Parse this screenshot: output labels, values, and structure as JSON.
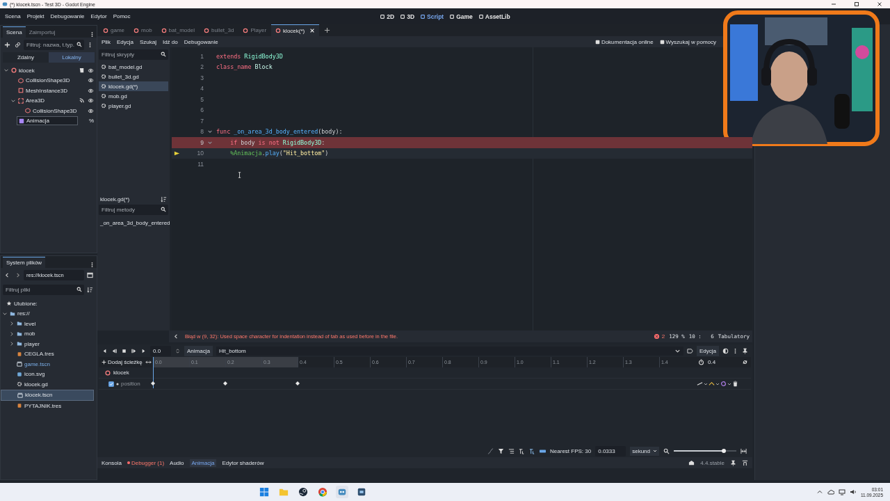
{
  "window": {
    "title": "(*) klocek.tscn - Test 3D - Godot Engine"
  },
  "menu": [
    "Scena",
    "Projekt",
    "Debugowanie",
    "Edytor",
    "Pomoc"
  ],
  "workspaces": [
    {
      "label": "2D",
      "selected": false
    },
    {
      "label": "3D",
      "selected": false
    },
    {
      "label": "Script",
      "selected": true
    },
    {
      "label": "Game",
      "selected": false
    },
    {
      "label": "AssetLib",
      "selected": false
    }
  ],
  "scene_dock": {
    "tabs": [
      {
        "label": "Scena",
        "selected": true
      },
      {
        "label": "Zaimportuj",
        "selected": false
      }
    ],
    "filter": {
      "placeholder": "Filtruj: nazwa, t.typ."
    },
    "modes": [
      {
        "label": "Zdalny",
        "selected": false
      },
      {
        "label": "Lokalny",
        "selected": true
      }
    ],
    "tree": [
      {
        "name": "klocek",
        "kind": "body",
        "expanded": true,
        "script": true,
        "visible": true,
        "children": [
          {
            "name": "CollisionShape3D",
            "kind": "shape",
            "visible": true
          },
          {
            "name": "MeshInstance3D",
            "kind": "mesh",
            "visible": true
          },
          {
            "name": "Area3D",
            "kind": "area",
            "expanded": true,
            "signals": true,
            "visible": true,
            "children": [
              {
                "name": "CollisionShape3D",
                "kind": "shape",
                "visible": true
              }
            ]
          },
          {
            "name": "Animacja",
            "kind": "animation",
            "editing": true,
            "badge": "%"
          }
        ]
      }
    ]
  },
  "filesystem": {
    "tab": "System plików",
    "path": "res://klocek.tscn",
    "filter": {
      "placeholder": "Filtruj pliki"
    },
    "favorites": "Ulubione:",
    "tree": [
      {
        "name": "res://",
        "kind": "folder",
        "expanded": true,
        "selected": false,
        "accent": false,
        "children": [
          {
            "name": "level",
            "kind": "folder",
            "expanded": false,
            "selected": false,
            "accent": false
          },
          {
            "name": "mob",
            "kind": "folder",
            "expanded": false,
            "selected": false,
            "accent": false
          },
          {
            "name": "player",
            "kind": "folder",
            "expanded": false,
            "selected": false,
            "accent": false
          },
          {
            "name": "CEGLA.tres",
            "kind": "resource",
            "selected": false,
            "accent": false
          },
          {
            "name": "game.tscn",
            "kind": "scene",
            "selected": false,
            "accent": true
          },
          {
            "name": "icon.svg",
            "selected": false,
            "accent": false
          },
          {
            "name": "klocek.gd",
            "kind": "script",
            "selected": false,
            "accent": false
          },
          {
            "name": "klocek.tscn",
            "kind": "scene",
            "selected": true,
            "accent": false
          },
          {
            "name": "PYTAJNIK.tres",
            "kind": "resource",
            "selected": false,
            "accent": false
          }
        ]
      }
    ]
  },
  "scene_tabs": [
    {
      "label": "game",
      "selected": false
    },
    {
      "label": "mob",
      "selected": false
    },
    {
      "label": "bat_model",
      "selected": false
    },
    {
      "label": "bullet_3d",
      "selected": false
    },
    {
      "label": "Player",
      "selected": false
    },
    {
      "label": "klocek(*)",
      "selected": true
    }
  ],
  "script_editor": {
    "menus": [
      "Plik",
      "Edycja",
      "Szukaj",
      "Idź do",
      "Debugowanie"
    ],
    "links": [
      "Dokumentacja online",
      "Wyszukaj w pomocy"
    ],
    "scripts_filter": {
      "placeholder": "Filtruj skrypty"
    },
    "scripts": [
      {
        "name": "bat_model.gd",
        "selected": false
      },
      {
        "name": "bullet_3d.gd",
        "selected": false
      },
      {
        "name": "klocek.gd(*)",
        "selected": true
      },
      {
        "name": "mob.gd",
        "selected": false
      },
      {
        "name": "player.gd",
        "selected": false
      }
    ],
    "current_script": "klocek.gd(*)",
    "methods_filter": {
      "placeholder": "Filtruj metody"
    },
    "methods": [
      "_on_area_3d_body_entered"
    ],
    "lines": [
      {
        "n": "1",
        "fold": false,
        "error": false,
        "current": false,
        "tokens": [
          {
            "text": "extends",
            "kind": "kw"
          },
          {
            "text": " RigidBody3D",
            "kind": "type"
          }
        ]
      },
      {
        "n": "2",
        "fold": false,
        "error": false,
        "current": false,
        "tokens": [
          {
            "text": "class_name",
            "kind": "kw"
          },
          {
            "text": " Block",
            "kind": "cls"
          }
        ]
      },
      {
        "n": "3",
        "fold": false,
        "error": false,
        "current": false
      },
      {
        "n": "4",
        "fold": false,
        "error": false,
        "current": false
      },
      {
        "n": "5",
        "fold": false,
        "error": false,
        "current": false
      },
      {
        "n": "6",
        "fold": false,
        "error": false,
        "current": false
      },
      {
        "n": "7",
        "fold": false,
        "error": false,
        "current": false
      },
      {
        "n": "8",
        "fold": true,
        "error": false,
        "current": false,
        "tokens": [
          {
            "text": "func",
            "kind": "kw"
          },
          {
            "text": " _on_area_3d_body_entered",
            "kind": "fn"
          },
          {
            "text": "(body):",
            "kind": "plain"
          }
        ]
      },
      {
        "n": "9",
        "fold": true,
        "error": true,
        "current": false,
        "tokens": [
          {
            "text": "    if",
            "kind": "kw"
          },
          {
            "text": " body ",
            "kind": "plain"
          },
          {
            "text": "is not",
            "kind": "kw"
          },
          {
            "text": " RigidBody3D",
            "kind": "type"
          },
          {
            "text": ":",
            "kind": "plain"
          }
        ]
      },
      {
        "n": "10",
        "fold": false,
        "error": false,
        "current": true,
        "tokens": [
          {
            "text": "\t%Animacja",
            "kind": "node"
          },
          {
            "text": ".",
            "kind": "plain"
          },
          {
            "text": "play",
            "kind": "fn"
          },
          {
            "text": "(",
            "kind": "plain"
          },
          {
            "text": "\"Hit_bottom\"",
            "kind": "str"
          },
          {
            "text": ")",
            "kind": "plain"
          }
        ]
      },
      {
        "n": "11",
        "fold": false,
        "error": false,
        "current": false
      }
    ]
  },
  "status": {
    "error": "Błąd w (9, 32): Used space character for indentation instead of tab as used before in the file.",
    "error_count": "2",
    "zoom": "129 %",
    "position": "10 :   6",
    "indent_mode": "Tabulatory"
  },
  "animation": {
    "time": "0.0",
    "animation_label": "Animacja",
    "animation": "Hit_bottom",
    "edit": "Edycja",
    "add_track": "Dodaj ścieżkę",
    "length": "0.4",
    "ticks": [
      {
        "label": "0.0",
        "in_range": true
      },
      {
        "label": "0.1",
        "in_range": true
      },
      {
        "label": "0.2",
        "in_range": true
      },
      {
        "label": "0.3",
        "in_range": true
      },
      {
        "label": "0.4",
        "in_range": false
      },
      {
        "label": "0.5",
        "in_range": false
      },
      {
        "label": "0.6",
        "in_range": false
      },
      {
        "label": "0.7",
        "in_range": false
      },
      {
        "label": "0.8",
        "in_range": false
      },
      {
        "label": "0.9",
        "in_range": false
      },
      {
        "label": "1.0",
        "in_range": false
      },
      {
        "label": "1.1",
        "in_range": false
      },
      {
        "label": "1.2",
        "in_range": false
      },
      {
        "label": "1.3",
        "in_range": false
      },
      {
        "label": "1.4",
        "in_range": false
      }
    ],
    "tracks": [
      {
        "name": "klocek",
        "kind": "node"
      },
      {
        "name": "position",
        "kind": "property",
        "checked": true,
        "keys": [
          true,
          false,
          true,
          false,
          true,
          false,
          false,
          false,
          false,
          false,
          false,
          false,
          false,
          false,
          false
        ]
      }
    ],
    "fps": "Nearest FPS: 30",
    "step": "0.0333",
    "unit": "sekund",
    "zoom": {
      "level": 0.8
    }
  },
  "bottom_tabs": [
    {
      "label": "Konsola",
      "selected": false,
      "alert": false
    },
    {
      "label": "Debugger (1)",
      "selected": false,
      "alert": true
    },
    {
      "label": "Audio",
      "selected": false,
      "alert": false
    },
    {
      "label": "Animacja",
      "selected": true,
      "alert": false
    },
    {
      "label": "Edytor shaderów",
      "selected": false,
      "alert": false
    }
  ],
  "version": "4.4.stable",
  "webcam": {
    "kind": "picture"
  },
  "taskbar": {
    "time": "03:01",
    "date": "11.09.2025"
  }
}
